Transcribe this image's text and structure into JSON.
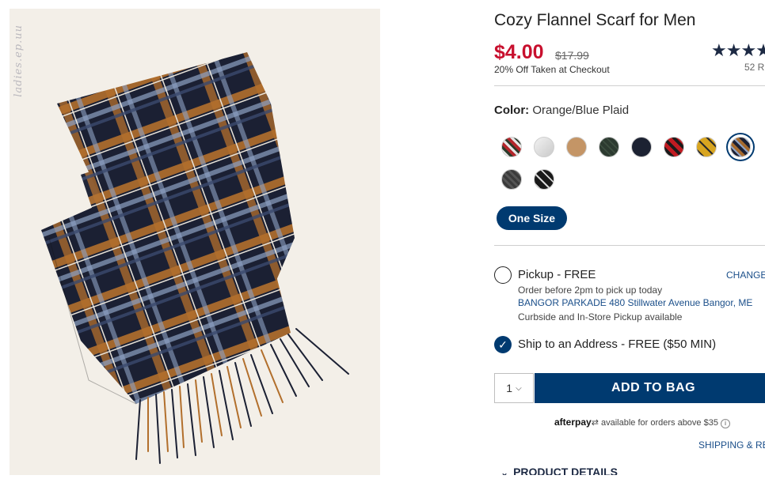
{
  "product": {
    "title": "Cozy Flannel Scarf for Men",
    "price": "$4.00",
    "original_price": "$17.99",
    "promo": "20% Off Taken at Checkout",
    "stars": "★★★★",
    "review_count": "52 R",
    "watermark": "ladies.ep.uu"
  },
  "color": {
    "label": "Color:",
    "value": "Orange/Blue Plaid",
    "swatches": [
      "red-plaid",
      "light-gray",
      "camel",
      "dark-green",
      "navy",
      "red-black-buffalo",
      "yellow-plaid",
      "orange-blue-plaid",
      "charcoal",
      "black-white-plaid"
    ]
  },
  "size": {
    "label": "One Size"
  },
  "fulfillment": {
    "pickup_label": "Pickup - FREE",
    "change_label": "CHANGE",
    "pickup_note": "Order before 2pm to pick up today",
    "store": "BANGOR PARKADE 480 Stillwater Avenue  Bangor, ME",
    "pickup_avail": "Curbside and In-Store Pickup available",
    "ship_label": "Ship to an Address - FREE ($50 MIN)"
  },
  "cart": {
    "qty": "1",
    "add_label": "ADD TO BAG"
  },
  "afterpay": {
    "brand": "afterpay",
    "text": "available for orders above $35"
  },
  "links": {
    "shipping": "SHIPPING & RE",
    "details": "PRODUCT DETAILS"
  },
  "colors": {
    "brand_navy": "#003a70",
    "sale_red": "#c8102e"
  }
}
